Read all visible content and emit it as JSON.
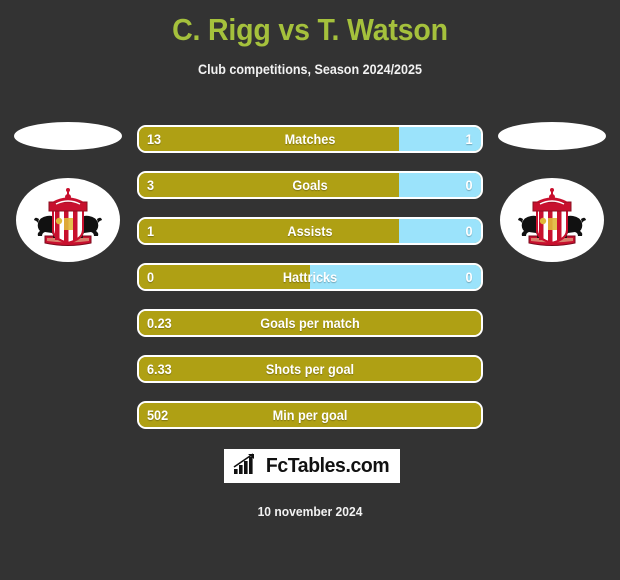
{
  "header": {
    "title": "C. Rigg vs T. Watson",
    "subtitle": "Club competitions, Season 2024/2025"
  },
  "colors": {
    "background": "#333333",
    "title": "#a5c13c",
    "bar_left": "#afa014",
    "bar_right": "#9be3fb",
    "bar_border": "#ffffff",
    "text": "#ffffff"
  },
  "teams": {
    "left": {
      "crest_name": "sunderland-afc-crest"
    },
    "right": {
      "crest_name": "sunderland-afc-crest"
    }
  },
  "stats": [
    {
      "label": "Matches",
      "left": "13",
      "right": "1",
      "left_pct": 76,
      "has_right": true
    },
    {
      "label": "Goals",
      "left": "3",
      "right": "0",
      "left_pct": 76,
      "has_right": true
    },
    {
      "label": "Assists",
      "left": "1",
      "right": "0",
      "left_pct": 76,
      "has_right": true
    },
    {
      "label": "Hattricks",
      "left": "0",
      "right": "0",
      "left_pct": 50,
      "has_right": true
    },
    {
      "label": "Goals per match",
      "left": "0.23",
      "right": "",
      "left_pct": 100,
      "has_right": false
    },
    {
      "label": "Shots per goal",
      "left": "6.33",
      "right": "",
      "left_pct": 100,
      "has_right": false
    },
    {
      "label": "Min per goal",
      "left": "502",
      "right": "",
      "left_pct": 100,
      "has_right": false
    }
  ],
  "footer": {
    "brand": "FcTables.com",
    "brand_icon": "bar-chart-trend-icon",
    "date": "10 november 2024"
  }
}
